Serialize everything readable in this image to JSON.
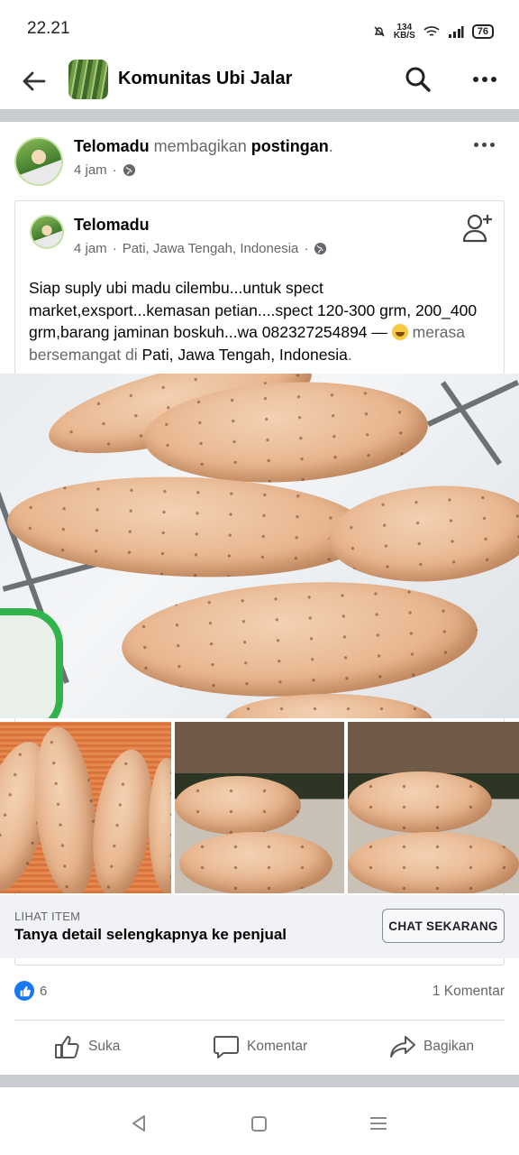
{
  "status_bar": {
    "time": "22.21",
    "net_speed_value": "134",
    "net_speed_unit": "KB/S",
    "battery": "76"
  },
  "header": {
    "group_name": "Komunitas Ubi Jalar"
  },
  "post": {
    "author": "Telomadu",
    "action_text": " membagikan ",
    "action_object": "postingan",
    "action_suffix": ".",
    "time": "4 jam"
  },
  "shared_post": {
    "author": "Telomadu",
    "time": "4 jam",
    "location": "Pati, Jawa Tengah, Indonesia",
    "body": "Siap suply ubi madu cilembu...untuk spect market,exsport...kemasan petian....spect 120-300 grm, 200_400 grm,barang jaminan boskuh...wa 082327254894 — ",
    "feeling": " merasa bersemangat di ",
    "feeling_place": "Pati, Jawa Tengah, Indonesia",
    "feeling_end": "."
  },
  "item_bar": {
    "kicker": "LIHAT ITEM",
    "title": "Tanya detail selengkapnya ke penjual",
    "button": "CHAT SEKARANG"
  },
  "engagement": {
    "like_count": "6",
    "comment_count": "1 Komentar"
  },
  "actions": {
    "like": "Suka",
    "comment": "Komentar",
    "share": "Bagikan"
  },
  "colors": {
    "accent": "#1877f2",
    "divider": "#c9ccd1",
    "secondary_text": "#65676b"
  }
}
